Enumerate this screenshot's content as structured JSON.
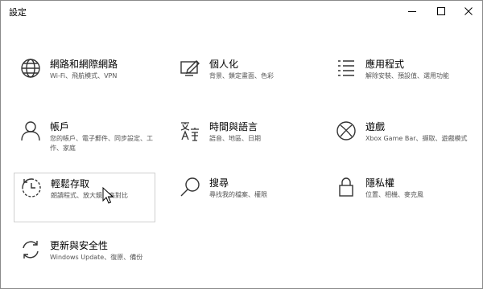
{
  "window": {
    "title": "設定"
  },
  "tiles": [
    {
      "label": "網路和網際網路",
      "desc": "Wi-Fi、飛航模式、VPN"
    },
    {
      "label": "個人化",
      "desc": "背景、鎖定畫面、色彩"
    },
    {
      "label": "應用程式",
      "desc": "解除安裝、預設值、選用功能"
    },
    {
      "label": "帳戶",
      "desc": "您的帳戶、電子郵件、同步設定、工作、家庭"
    },
    {
      "label": "時間與語言",
      "desc": "語音、地區、日期"
    },
    {
      "label": "遊戲",
      "desc": "Xbox Game Bar、擷取、遊戲模式"
    },
    {
      "label": "輕鬆存取",
      "desc": "朗讀程式、放大鏡、高對比"
    },
    {
      "label": "搜尋",
      "desc": "尋找我的檔案、權限"
    },
    {
      "label": "隱私權",
      "desc": "位置、相機、麥克風"
    },
    {
      "label": "更新與安全性",
      "desc": "Windows Update、復原、備份"
    }
  ],
  "icons": {
    "tile_0": "globe-icon",
    "tile_1": "personalization-icon",
    "tile_2": "apps-list-icon",
    "tile_3": "person-icon",
    "tile_4": "time-language-icon",
    "tile_5": "xbox-icon",
    "tile_6": "ease-of-access-icon",
    "tile_7": "search-icon",
    "tile_8": "lock-icon",
    "tile_9": "sync-icon"
  },
  "colors": {
    "icon": "#333333",
    "hover_border": "#cfcfcf",
    "desc_text": "#555555"
  }
}
